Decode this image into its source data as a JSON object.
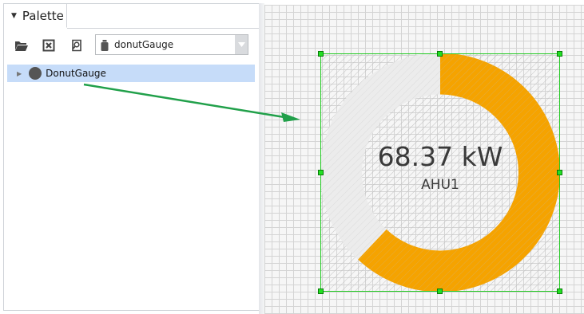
{
  "palette": {
    "tab_label": "Palette",
    "toolbar": {
      "open_icon": "folder-open-icon",
      "close_icon": "close-box-icon",
      "find_icon": "find-icon",
      "module_select": {
        "value": "donutGauge",
        "icon": "jar-icon"
      }
    },
    "tree": [
      {
        "label": "DonutGauge",
        "icon": "component-dot-icon",
        "selected": true
      }
    ]
  },
  "gauge": {
    "value_text": "68.37 kW",
    "name_text": "AHU1",
    "fill_fraction": 0.62,
    "colors": {
      "fill": "#f5a300",
      "track": "#ececec",
      "selection": "#22c922",
      "arrow": "#21a04a"
    }
  }
}
